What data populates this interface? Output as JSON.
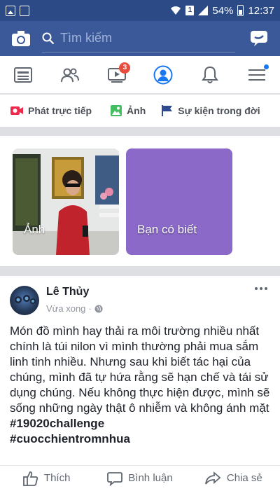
{
  "status_bar": {
    "battery": "54%",
    "time": "12:37",
    "sim_label": "1"
  },
  "search": {
    "placeholder": "Tìm kiếm"
  },
  "tabs": [
    {
      "id": "feed",
      "icon": "news-feed-icon"
    },
    {
      "id": "friends",
      "icon": "friends-icon"
    },
    {
      "id": "watch",
      "icon": "video-icon",
      "badge": "3"
    },
    {
      "id": "profile",
      "icon": "profile-icon"
    },
    {
      "id": "notifications",
      "icon": "bell-icon"
    },
    {
      "id": "menu",
      "icon": "menu-icon"
    }
  ],
  "actions": {
    "live": "Phát trực tiếp",
    "photo": "Ảnh",
    "life_event": "Sự kiện trong đời"
  },
  "stories": {
    "photo_card": "Ảnh",
    "know_card": "Bạn có biết"
  },
  "post": {
    "author": "Lê Thủy",
    "time": "Vừa xong",
    "text": "Món đồ mình hay thải ra môi trường nhiều nhất chính là túi nilon vì mình thường phải mua sắm linh tinh nhiều. Nhưng sau khi biết tác hại của chúng, mình đã tự hứa rằng sẽ hạn chế và tái sử dụng chúng. Nếu không thực hiện được, mình sẽ sống những ngày thật ô nhiễm và không ánh mặt",
    "hashtag1": "#19020challenge",
    "hashtag2": "#cuocchientromnhua",
    "like": "Thích",
    "comment": "Bình luận",
    "share": "Chia sẻ"
  },
  "colors": {
    "brand": "#3b5998",
    "story_purple": "#8a69c8",
    "live_red": "#f02849",
    "badge_red": "#e84c3d"
  }
}
